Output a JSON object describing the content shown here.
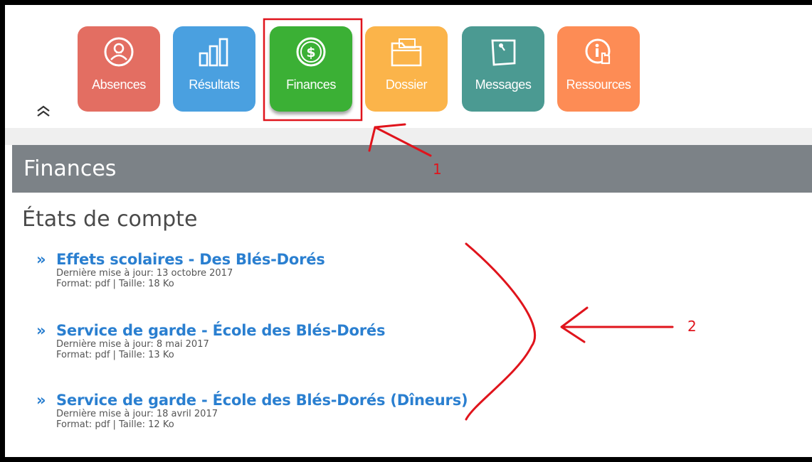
{
  "toolbar": {
    "tiles": [
      {
        "label": "Absences",
        "icon": "person-circle-icon",
        "color": "#e36e62"
      },
      {
        "label": "Résultats",
        "icon": "bar-chart-icon",
        "color": "#4aa0e0"
      },
      {
        "label": "Finances",
        "icon": "dollar-coin-icon",
        "color": "#3bb035"
      },
      {
        "label": "Dossier",
        "icon": "folder-icon",
        "color": "#fbb44a"
      },
      {
        "label": "Messages",
        "icon": "note-pin-icon",
        "color": "#4b9a92"
      },
      {
        "label": "Ressources",
        "icon": "info-hand-icon",
        "color": "#fd8c55"
      }
    ],
    "collapse_icon": "double-chevron-up-icon"
  },
  "section": {
    "title": "Finances",
    "header_color": "#7c8287"
  },
  "main": {
    "title": "États de compte",
    "chevron": "»",
    "documents": [
      {
        "title": "Effets scolaires - Des Blés-Dorés",
        "updated": "Dernière mise à jour: 13 octobre 2017",
        "format": "Format: pdf | Taille: 18 Ko"
      },
      {
        "title": "Service de garde - École des Blés-Dorés",
        "updated": "Dernière mise à jour: 8 mai 2017",
        "format": "Format: pdf | Taille: 13 Ko"
      },
      {
        "title": "Service de garde - École des Blés-Dorés (Dîneurs)",
        "updated": "Dernière mise à jour: 18 avril 2017",
        "format": "Format: pdf | Taille: 12 Ko"
      }
    ],
    "link_color": "#2a7fd0"
  },
  "annotations": {
    "label_1": "1",
    "label_2": "2",
    "color": "#e0141c"
  }
}
